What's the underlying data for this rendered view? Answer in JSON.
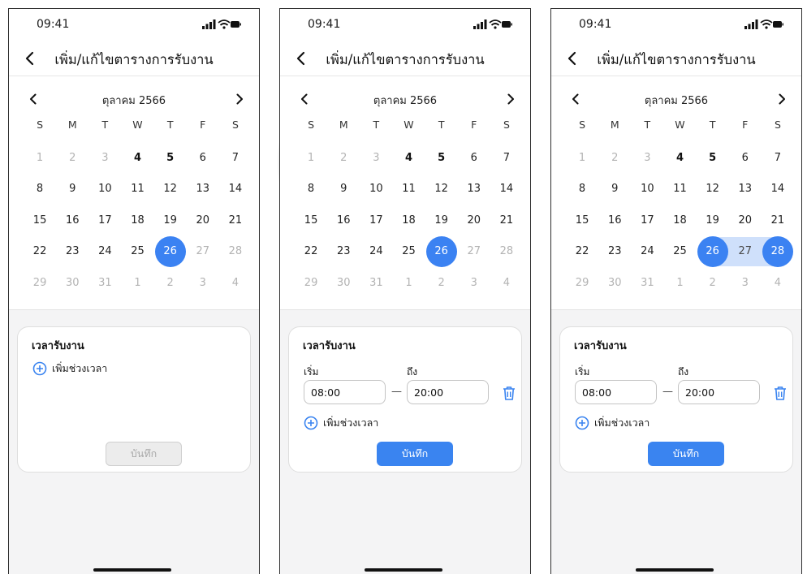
{
  "screens": [
    {
      "status_time": "09:41",
      "title": "เพิ่ม/แก้ไขตารางการรับงาน",
      "month_label": "ตุลาคม 2566",
      "weekdays": [
        "S",
        "M",
        "T",
        "W",
        "T",
        "F",
        "S"
      ],
      "days": [
        {
          "n": "1",
          "s": "muted"
        },
        {
          "n": "2",
          "s": "muted"
        },
        {
          "n": "3",
          "s": "muted"
        },
        {
          "n": "4",
          "s": "bold"
        },
        {
          "n": "5",
          "s": "bold"
        },
        {
          "n": "6",
          "s": "normal"
        },
        {
          "n": "7",
          "s": "normal"
        },
        {
          "n": "8",
          "s": "normal"
        },
        {
          "n": "9",
          "s": "normal"
        },
        {
          "n": "10",
          "s": "normal"
        },
        {
          "n": "11",
          "s": "normal"
        },
        {
          "n": "12",
          "s": "normal"
        },
        {
          "n": "13",
          "s": "normal"
        },
        {
          "n": "14",
          "s": "normal"
        },
        {
          "n": "15",
          "s": "normal"
        },
        {
          "n": "16",
          "s": "normal"
        },
        {
          "n": "17",
          "s": "normal"
        },
        {
          "n": "18",
          "s": "normal"
        },
        {
          "n": "19",
          "s": "normal"
        },
        {
          "n": "20",
          "s": "normal"
        },
        {
          "n": "21",
          "s": "normal"
        },
        {
          "n": "22",
          "s": "normal"
        },
        {
          "n": "23",
          "s": "normal"
        },
        {
          "n": "24",
          "s": "normal"
        },
        {
          "n": "25",
          "s": "normal"
        },
        {
          "n": "26",
          "s": "selected"
        },
        {
          "n": "27",
          "s": "muted"
        },
        {
          "n": "28",
          "s": "muted"
        },
        {
          "n": "29",
          "s": "muted"
        },
        {
          "n": "30",
          "s": "muted"
        },
        {
          "n": "31",
          "s": "muted"
        },
        {
          "n": "1",
          "s": "muted"
        },
        {
          "n": "2",
          "s": "muted"
        },
        {
          "n": "3",
          "s": "muted"
        },
        {
          "n": "4",
          "s": "muted"
        }
      ],
      "card_title": "เวลารับงาน",
      "start_label": "",
      "end_label": "",
      "start_time": "",
      "end_time": "",
      "add_slot_label": "เพิ่มช่วงเวลา",
      "save_label": "บันทึก",
      "save_enabled": false
    },
    {
      "status_time": "09:41",
      "title": "เพิ่ม/แก้ไขตารางการรับงาน",
      "month_label": "ตุลาคม 2566",
      "weekdays": [
        "S",
        "M",
        "T",
        "W",
        "T",
        "F",
        "S"
      ],
      "days": [
        {
          "n": "1",
          "s": "muted"
        },
        {
          "n": "2",
          "s": "muted"
        },
        {
          "n": "3",
          "s": "muted"
        },
        {
          "n": "4",
          "s": "bold"
        },
        {
          "n": "5",
          "s": "bold"
        },
        {
          "n": "6",
          "s": "normal"
        },
        {
          "n": "7",
          "s": "normal"
        },
        {
          "n": "8",
          "s": "normal"
        },
        {
          "n": "9",
          "s": "normal"
        },
        {
          "n": "10",
          "s": "normal"
        },
        {
          "n": "11",
          "s": "normal"
        },
        {
          "n": "12",
          "s": "normal"
        },
        {
          "n": "13",
          "s": "normal"
        },
        {
          "n": "14",
          "s": "normal"
        },
        {
          "n": "15",
          "s": "normal"
        },
        {
          "n": "16",
          "s": "normal"
        },
        {
          "n": "17",
          "s": "normal"
        },
        {
          "n": "18",
          "s": "normal"
        },
        {
          "n": "19",
          "s": "normal"
        },
        {
          "n": "20",
          "s": "normal"
        },
        {
          "n": "21",
          "s": "normal"
        },
        {
          "n": "22",
          "s": "normal"
        },
        {
          "n": "23",
          "s": "normal"
        },
        {
          "n": "24",
          "s": "normal"
        },
        {
          "n": "25",
          "s": "normal"
        },
        {
          "n": "26",
          "s": "selected"
        },
        {
          "n": "27",
          "s": "muted"
        },
        {
          "n": "28",
          "s": "muted"
        },
        {
          "n": "29",
          "s": "muted"
        },
        {
          "n": "30",
          "s": "muted"
        },
        {
          "n": "31",
          "s": "muted"
        },
        {
          "n": "1",
          "s": "muted"
        },
        {
          "n": "2",
          "s": "muted"
        },
        {
          "n": "3",
          "s": "muted"
        },
        {
          "n": "4",
          "s": "muted"
        }
      ],
      "card_title": "เวลารับงาน",
      "start_label": "เริ่ม",
      "end_label": "ถึง",
      "start_time": "08:00",
      "end_time": "20:00",
      "add_slot_label": "เพิ่มช่วงเวลา",
      "save_label": "บันทึก",
      "save_enabled": true
    },
    {
      "status_time": "09:41",
      "title": "เพิ่ม/แก้ไขตารางการรับงาน",
      "month_label": "ตุลาคม 2566",
      "weekdays": [
        "S",
        "M",
        "T",
        "W",
        "T",
        "F",
        "S"
      ],
      "days": [
        {
          "n": "1",
          "s": "muted"
        },
        {
          "n": "2",
          "s": "muted"
        },
        {
          "n": "3",
          "s": "muted"
        },
        {
          "n": "4",
          "s": "bold"
        },
        {
          "n": "5",
          "s": "bold"
        },
        {
          "n": "6",
          "s": "normal"
        },
        {
          "n": "7",
          "s": "normal"
        },
        {
          "n": "8",
          "s": "normal"
        },
        {
          "n": "9",
          "s": "normal"
        },
        {
          "n": "10",
          "s": "normal"
        },
        {
          "n": "11",
          "s": "normal"
        },
        {
          "n": "12",
          "s": "normal"
        },
        {
          "n": "13",
          "s": "normal"
        },
        {
          "n": "14",
          "s": "normal"
        },
        {
          "n": "15",
          "s": "normal"
        },
        {
          "n": "16",
          "s": "normal"
        },
        {
          "n": "17",
          "s": "normal"
        },
        {
          "n": "18",
          "s": "normal"
        },
        {
          "n": "19",
          "s": "normal"
        },
        {
          "n": "20",
          "s": "normal"
        },
        {
          "n": "21",
          "s": "normal"
        },
        {
          "n": "22",
          "s": "normal"
        },
        {
          "n": "23",
          "s": "normal"
        },
        {
          "n": "24",
          "s": "normal"
        },
        {
          "n": "25",
          "s": "normal"
        },
        {
          "n": "26",
          "s": "range-start"
        },
        {
          "n": "27",
          "s": "in-range"
        },
        {
          "n": "28",
          "s": "range-end"
        },
        {
          "n": "29",
          "s": "muted"
        },
        {
          "n": "30",
          "s": "muted"
        },
        {
          "n": "31",
          "s": "muted"
        },
        {
          "n": "1",
          "s": "muted"
        },
        {
          "n": "2",
          "s": "muted"
        },
        {
          "n": "3",
          "s": "muted"
        },
        {
          "n": "4",
          "s": "muted"
        }
      ],
      "card_title": "เวลารับงาน",
      "start_label": "เริ่ม",
      "end_label": "ถึง",
      "start_time": "08:00",
      "end_time": "20:00",
      "add_slot_label": "เพิ่มช่วงเวลา",
      "save_label": "บันทึก",
      "save_enabled": true
    }
  ],
  "icons": {
    "back": "chevron-left-icon",
    "prev_month": "chevron-left-icon",
    "next_month": "chevron-right-icon",
    "add": "plus-circle-icon",
    "delete": "trash-icon",
    "signal": "cellular-signal-icon",
    "wifi": "wifi-icon",
    "battery": "battery-icon"
  },
  "colors": {
    "accent": "#3b82f2",
    "range_fill": "#cfe0fb",
    "muted_text": "#b3b3b3",
    "disabled_button": "#ececec",
    "panel_bg": "#f4f4f5"
  }
}
